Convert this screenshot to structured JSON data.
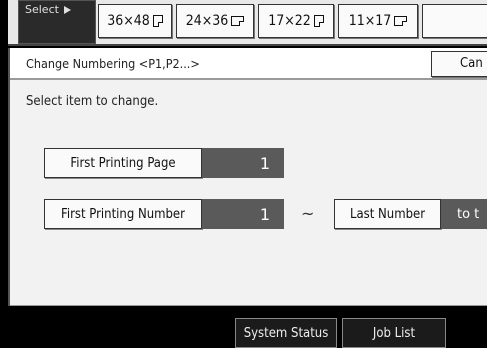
{
  "top_strip": {
    "select_label": "Select",
    "sizes": [
      {
        "label": "36×48",
        "icon": "portrait-page-icon"
      },
      {
        "label": "24×36",
        "icon": "landscape-page-icon"
      },
      {
        "label": "17×22",
        "icon": "portrait-page-icon"
      },
      {
        "label": "11×17",
        "icon": "landscape-page-icon"
      }
    ]
  },
  "panel": {
    "title": "Change Numbering <P1,P2...>",
    "cancel_label": "Can",
    "instruction": "Select item to change.",
    "first_printing_page": {
      "label": "First Printing Page",
      "value": "1"
    },
    "first_printing_number": {
      "label": "First Printing Number",
      "value": "1"
    },
    "range_separator": "~",
    "last_number": {
      "label": "Last Number",
      "value": "to t"
    }
  },
  "status_bar": {
    "system_status_label": "System Status",
    "job_list_label": "Job List"
  }
}
